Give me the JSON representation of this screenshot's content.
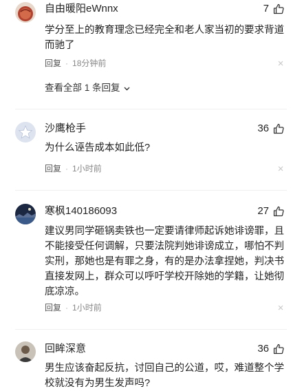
{
  "comments": [
    {
      "username": "自由暖阳eWnnx",
      "likes": "7",
      "text": "学分至上的教育理念已经完全和老人家当初的要求背道而驰了",
      "reply_label": "回复",
      "time": "18分钟前",
      "view_replies": "查看全部 1 条回复"
    },
    {
      "username": "沙鹰枪手",
      "likes": "36",
      "text": "为什么诬告成本如此低?",
      "reply_label": "回复",
      "time": "1小时前"
    },
    {
      "username": "寒枫140186093",
      "likes": "27",
      "text": "建议男同学砸锅卖铁也一定要请律师起诉她诽谤罪，且不能接受任何调解，只要法院判她诽谤成立，哪怕不判实刑，那她也是有罪之身，有的是办法拿捏她，判决书直接发网上，群众可以呼吁学校开除她的学籍，让她彻底凉凉。",
      "reply_label": "回复",
      "time": "1小时前"
    },
    {
      "username": "回眸深意",
      "likes": "36",
      "text": "男生应该奋起反抗，讨回自己的公道，哎，难道整个学校就没有为男生发声吗?"
    }
  ],
  "icons": {
    "like": "thumbs-up-icon",
    "close": "close-icon",
    "expand": "chevron-down-icon"
  }
}
